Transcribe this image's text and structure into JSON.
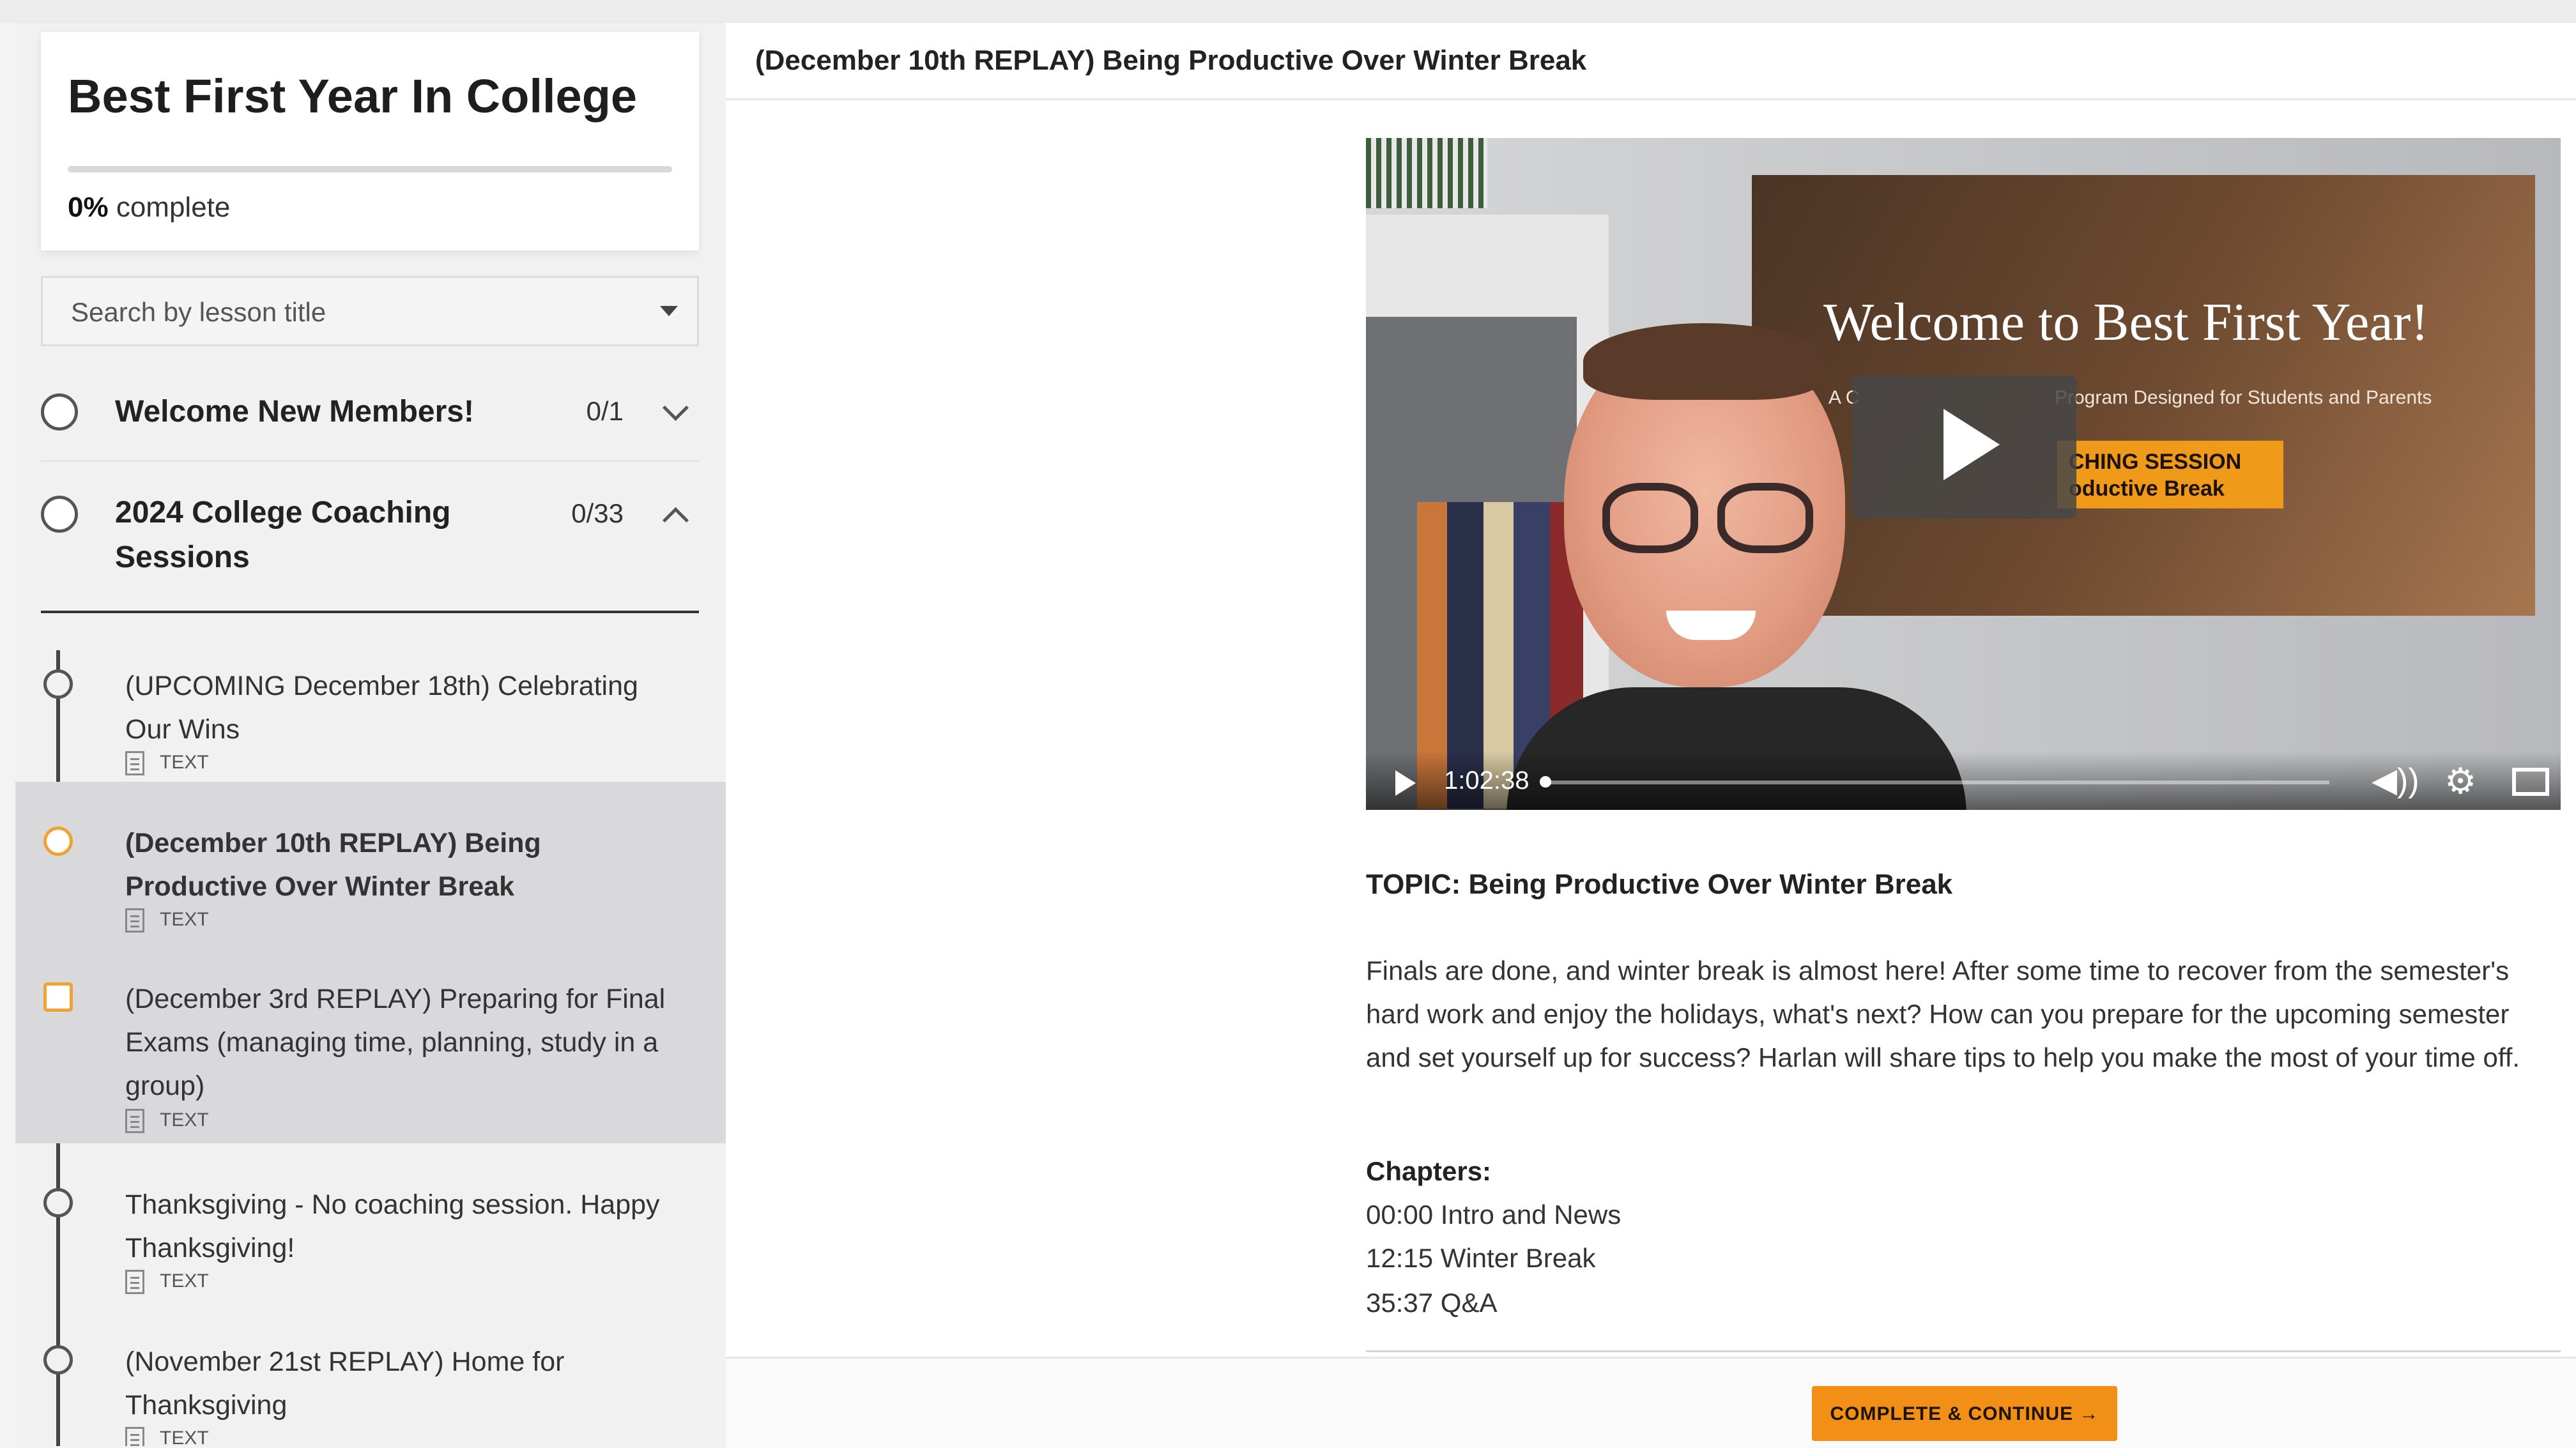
{
  "course": {
    "title": "Best First Year In College",
    "progress_percent": 0,
    "progress_value": "0%",
    "progress_label": " complete"
  },
  "search": {
    "placeholder": "Search by lesson title"
  },
  "sections": [
    {
      "title": "Welcome New Members!",
      "count": "0/1",
      "expanded": false
    },
    {
      "title": "2024 College Coaching Sessions",
      "count": "0/33",
      "expanded": true
    }
  ],
  "lessons": [
    {
      "title": "(UPCOMING December 18th) Celebrating Our Wins",
      "type": "TEXT"
    },
    {
      "title": "(December 10th REPLAY) Being Productive Over Winter Break",
      "type": "TEXT"
    },
    {
      "title": "(December 3rd REPLAY) Preparing for Final Exams (managing time, planning, study in a group)",
      "type": "TEXT"
    },
    {
      "title": "Thanksgiving - No coaching session. Happy Thanksgiving!",
      "type": "TEXT"
    },
    {
      "title": "(November 21st REPLAY) Home for Thanksgiving",
      "type": "TEXT"
    }
  ],
  "main": {
    "title": "(December 10th REPLAY) Being Productive Over Winter Break",
    "video": {
      "slide_title": "Welcome to Best First Year!",
      "slide_sub_a": "A C",
      "slide_sub_b": "Program Designed for Students and Parents",
      "badge_line1": "CHING SESSION",
      "badge_line2": "oductive Break",
      "time": "1:02:38",
      "progress_fraction": 0.01
    },
    "topic": "TOPIC: Being Productive Over Winter Break",
    "description": "Finals are done, and winter break is almost here! After some time to recover from the semester's hard work and enjoy the holidays, what's next? How can you prepare for the upcoming semester and set yourself up for success? Harlan will share tips to help you make the most of your time off.",
    "chapters_heading": "Chapters:",
    "chapters": [
      "00:00 Intro and News",
      "12:15 Winter Break",
      "35:37 Q&A"
    ],
    "complete_button": "COMPLETE & CONTINUE →"
  },
  "colors": {
    "accent": "#f28f16",
    "active_lesson_bg": "#d9d9dc"
  },
  "icons": {
    "section_status": "empty-circle-icon",
    "lesson_type": "document-icon",
    "collapse": "chevron-up-icon",
    "expand": "chevron-down-icon"
  }
}
